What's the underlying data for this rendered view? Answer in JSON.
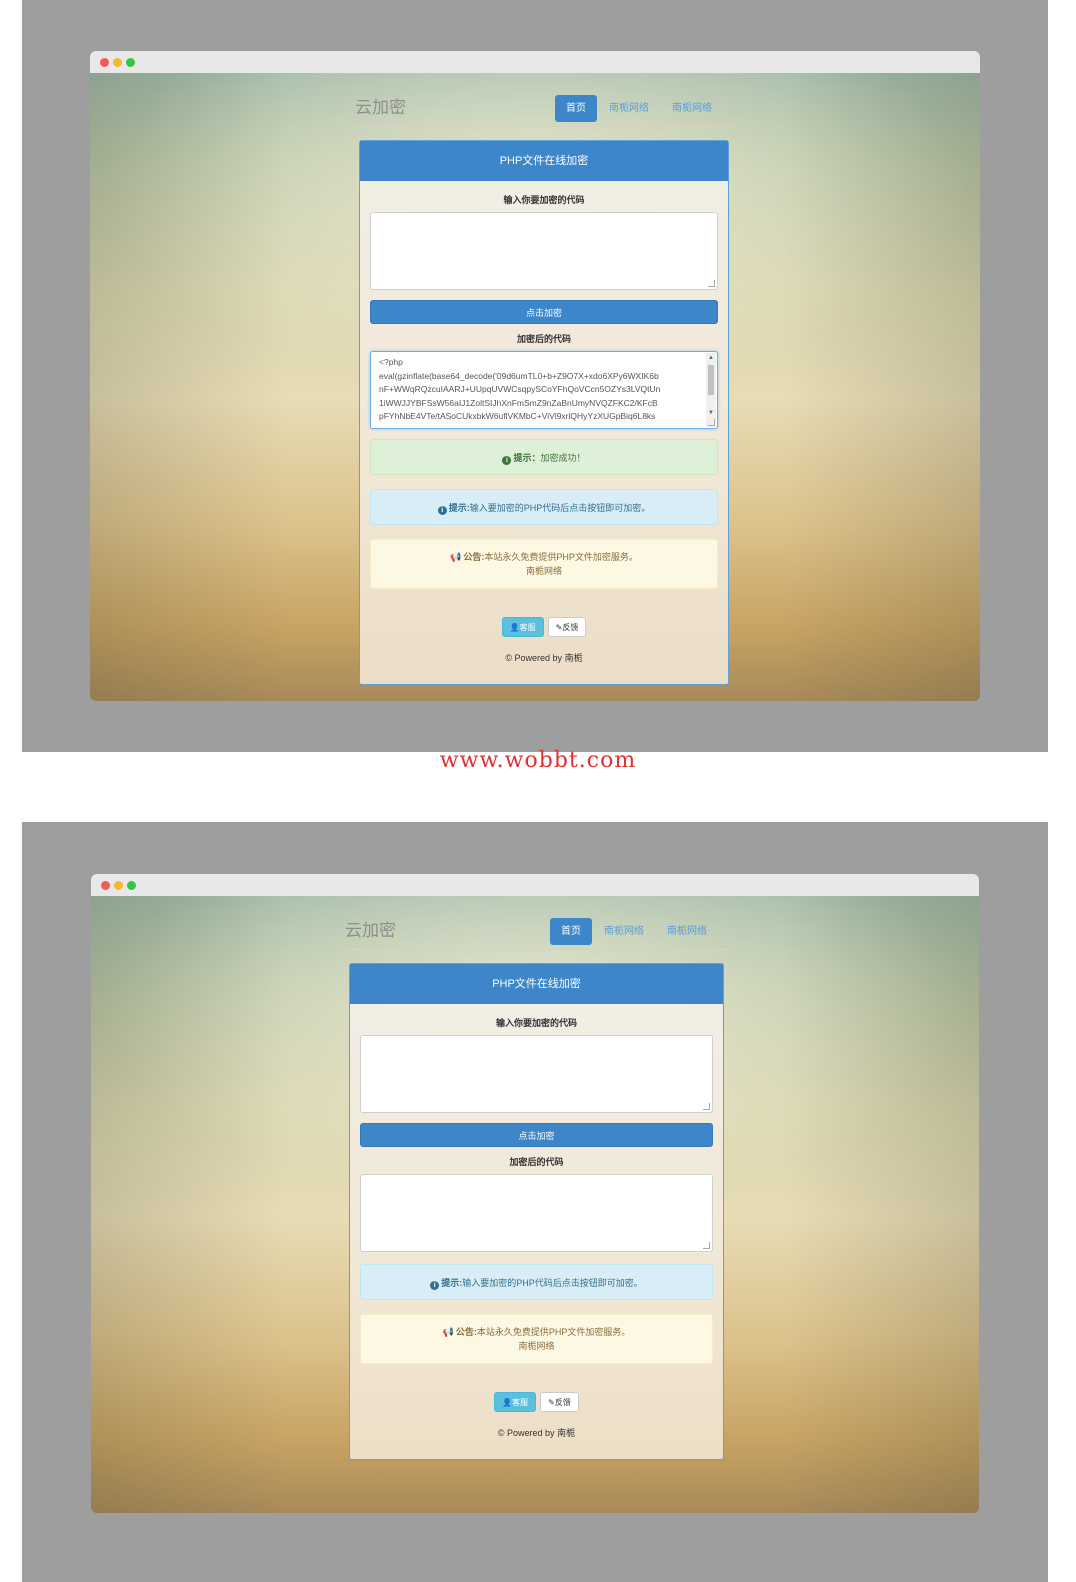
{
  "screens": {
    "first": {
      "brand": "云加密",
      "nav": [
        "首页",
        "南栀网络",
        "南栀网络"
      ],
      "card_title": "PHP文件在线加密",
      "input_label": "输入你要加密的代码",
      "input_value": "",
      "encrypt_button": "点击加密",
      "output_label": "加密后的代码",
      "output_value": "<?php\neval(gzinflate(base64_decode('09d6umTL0+b+Z9O7X+xdo6XPy6WXIK6b\nnF+WWqRQzcuIAARJ+UUpqUVWCsqpySCoYFhQoVCcn5OZYs3LVQtUn\n1iWWJJYBFSsW56aIJ1ZoltSIJhXnFmSmZ9nZaBnUmyNVQZFKC2/KFcB\npFYhNbE4VTe/tASoCUkxbkW6uflVKMbC+ViVl9xrlQHyYzXUGpBiq6L8ks",
      "success_label": "提示：",
      "success_text": "加密成功！",
      "info_label": "提示:",
      "info_text": "输入要加密的PHP代码后点击按钮即可加密。",
      "notice_label": "公告:",
      "notice_text": "本站永久免费提供PHP文件加密服务。",
      "notice_sub": "南栀网络",
      "support_button": "客服",
      "feedback_button": "反馈",
      "footer_prefix": "© Powered by",
      "footer_name": "南栀"
    },
    "second": {
      "brand": "云加密",
      "nav": [
        "首页",
        "南栀网络",
        "南栀网络"
      ],
      "card_title": "PHP文件在线加密",
      "input_label": "输入你要加密的代码",
      "input_value": "",
      "encrypt_button": "点击加密",
      "output_label": "加密后的代码",
      "output_value": "",
      "info_label": "提示:",
      "info_text": "输入要加密的PHP代码后点击按钮即可加密。",
      "notice_label": "公告:",
      "notice_text": "本站永久免费提供PHP文件加密服务。",
      "notice_sub": "南栀网络",
      "support_button": "客服",
      "feedback_button": "反馈",
      "footer_prefix": "© Powered by",
      "footer_name": "南栀"
    }
  },
  "watermark": "www.wobbt.com",
  "icons": {
    "info": "info-circle-icon",
    "notice": "megaphone-icon",
    "support": "user-icon",
    "feedback": "pencil-icon"
  },
  "colors": {
    "primary": "#3d86c9",
    "success_bg": "#dff0d8",
    "info_bg": "#d9edf7",
    "warning_bg": "#fcf8e3",
    "watermark": "#e03030"
  }
}
